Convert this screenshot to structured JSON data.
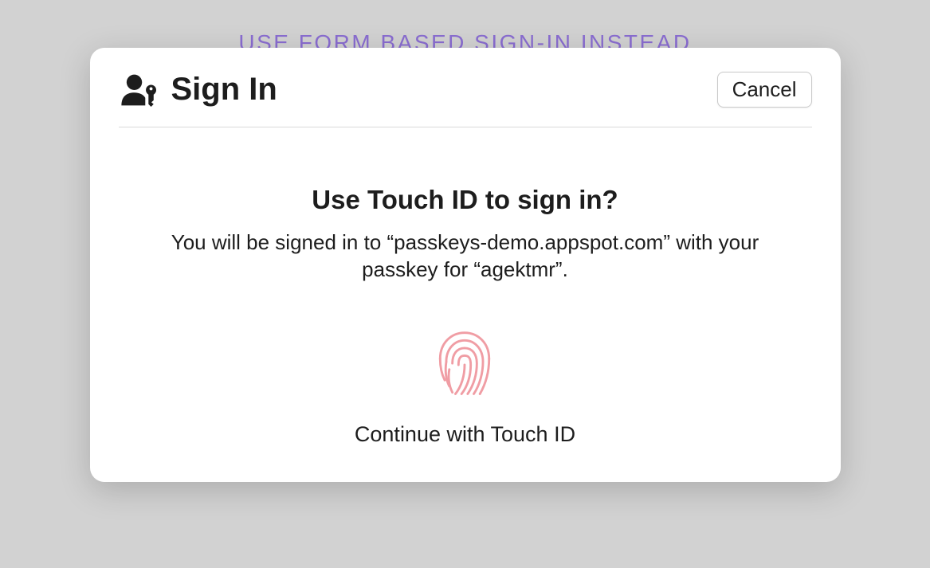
{
  "page": {
    "form_link_label": "USE FORM BASED SIGN-IN INSTEAD"
  },
  "dialog": {
    "title": "Sign In",
    "cancel_label": "Cancel",
    "body_title": "Use Touch ID to sign in?",
    "body_description": "You will be signed in to “passkeys-demo.appspot.com” with your passkey for “agektmr”.",
    "continue_label": "Continue with Touch ID"
  },
  "colors": {
    "link": "#8a6dd1",
    "fingerprint": "#f09da4"
  }
}
